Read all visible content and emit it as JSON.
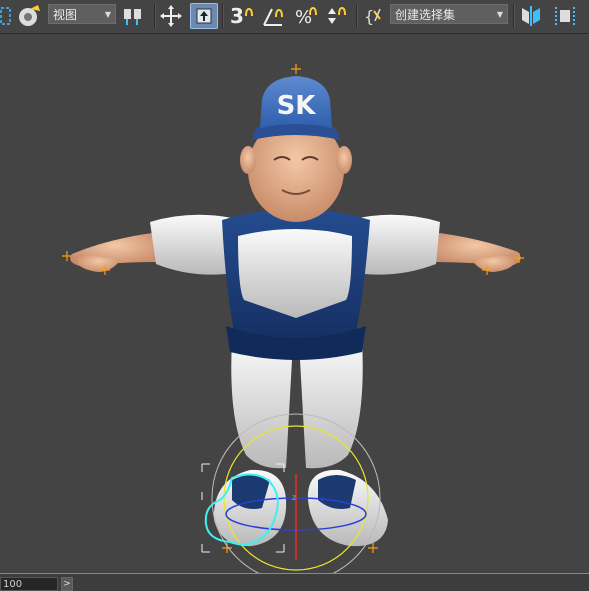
{
  "toolbar": {
    "view_dropdown": {
      "value": "视图"
    },
    "selection_set_dropdown": {
      "value": "创建选择集"
    },
    "snap_toggle_label": "3",
    "icons": [
      "selection-region-icon",
      "link-icon",
      "move-transform-icon",
      "select-and-move-icon",
      "snap-toggle-icon",
      "angle-snap-icon",
      "percent-snap-icon",
      "spinner-snap-icon",
      "edit-named-selection-icon",
      "mirror-icon",
      "align-icon"
    ]
  },
  "viewport": {
    "character": {
      "cap_text": "SK"
    },
    "colors": {
      "background": "#444444",
      "jersey_blue": "#1e3f7d",
      "gizmo_yellow": "#e6e62a",
      "spline_cyan": "#3ff0f0"
    }
  },
  "bottom_bar": {
    "time_value": "100",
    "next_label": ">"
  }
}
